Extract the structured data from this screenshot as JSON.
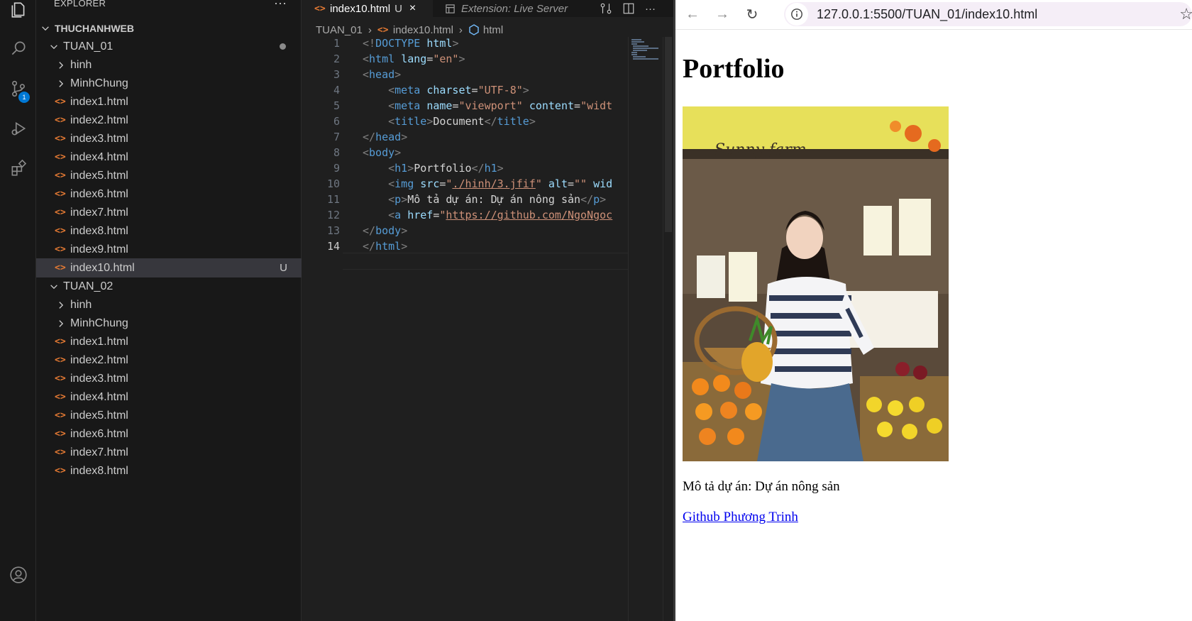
{
  "explorer": {
    "title": "EXPLORER",
    "more": "···",
    "root": "THUCHANHWEB",
    "tuan01": {
      "name": "TUAN_01",
      "folders": [
        "hinh",
        "MinhChung"
      ],
      "files": [
        "index1.html",
        "index2.html",
        "index3.html",
        "index4.html",
        "index5.html",
        "index6.html",
        "index7.html",
        "index8.html",
        "index9.html",
        "index10.html"
      ],
      "selected_status": "U"
    },
    "tuan02": {
      "name": "TUAN_02",
      "folders": [
        "hinh",
        "MinhChung"
      ],
      "files": [
        "index1.html",
        "index2.html",
        "index3.html",
        "index4.html",
        "index5.html",
        "index6.html",
        "index7.html",
        "index8.html"
      ]
    }
  },
  "activity": {
    "source_control_badge": "1"
  },
  "editor": {
    "tabs": [
      {
        "label": "index10.html",
        "status": "U",
        "close": "×"
      },
      {
        "label": "Extension: Live Server"
      }
    ],
    "more": "···",
    "breadcrumb": [
      "TUAN_01",
      "index10.html",
      "html"
    ],
    "line_numbers": [
      "1",
      "2",
      "3",
      "4",
      "5",
      "6",
      "7",
      "8",
      "9",
      "10",
      "11",
      "12",
      "13",
      "14"
    ],
    "code_lines": [
      "<!DOCTYPE html>",
      "<html lang=\"en\">",
      "<head>",
      "    <meta charset=\"UTF-8\">",
      "    <meta name=\"viewport\" content=\"widt",
      "    <title>Document</title>",
      "</head>",
      "<body>",
      "    <h1>Portfolio</h1>",
      "    <img src=\"./hinh/3.jfif\" alt=\"\" wid",
      "    <p>Mô tả dự án: Dự án nông sản</p>",
      "    <a href=\"https://github.com/NgoNgoc",
      "</body>",
      "</html>"
    ]
  },
  "browser": {
    "url": "127.0.0.1:5500/TUAN_01/index10.html",
    "back": "←",
    "forward": "→",
    "reload": "↻",
    "star": "☆",
    "heading": "Portfolio",
    "photo_sign": "Sunny farm",
    "description": "Mô tả dự án: Dự án nông sản",
    "link_text": "Github Phương Trinh"
  },
  "colors": {
    "sidebar_bg": "#181818",
    "editor_bg": "#1f1f1f",
    "selection_bg": "#37373d",
    "html_icon": "#e37933",
    "tag": "#569cd6",
    "attribute": "#9cdcfe",
    "string": "#ce9178",
    "link": "#0000ee",
    "badge": "#0078d4"
  }
}
